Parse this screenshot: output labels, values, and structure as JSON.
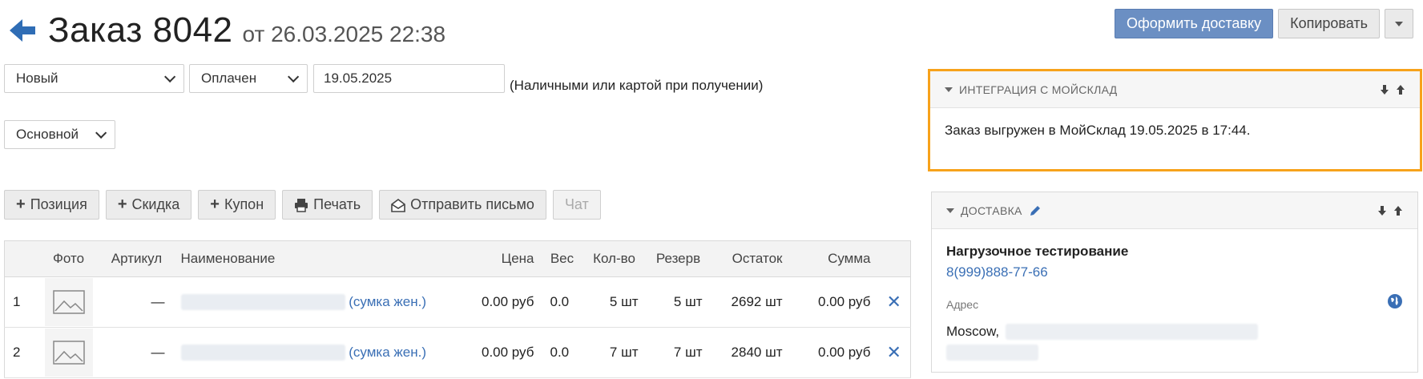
{
  "header": {
    "title": "Заказ 8042",
    "from_label": "от 26.03.2025 22:38"
  },
  "actions": {
    "primary": "Оформить доставку",
    "copy": "Копировать"
  },
  "form": {
    "status": "Новый",
    "payment_status": "Оплачен",
    "date": "19.05.2025",
    "payment_note": "(Наличными или картой при получении)",
    "warehouse": "Основной"
  },
  "toolbar": {
    "position": "Позиция",
    "discount": "Скидка",
    "coupon": "Купон",
    "print": "Печать",
    "send_email": "Отправить письмо",
    "chat": "Чат"
  },
  "table": {
    "headers": {
      "photo": "Фото",
      "sku": "Артикул",
      "name": "Наименование",
      "price": "Цена",
      "weight": "Вес",
      "qty": "Кол-во",
      "reserve": "Резерв",
      "stock": "Остаток",
      "sum": "Сумма"
    },
    "rows": [
      {
        "idx": "1",
        "sku": "—",
        "name_suffix": "(сумка жен.)",
        "price": "0.00 руб",
        "weight": "0.0",
        "qty": "5 шт",
        "reserve": "5 шт",
        "stock": "2692 шт",
        "sum": "0.00 руб"
      },
      {
        "idx": "2",
        "sku": "—",
        "name_suffix": "(сумка жен.)",
        "price": "0.00 руб",
        "weight": "0.0",
        "qty": "7 шт",
        "reserve": "7 шт",
        "stock": "2840 шт",
        "sum": "0.00 руб"
      }
    ]
  },
  "integration_panel": {
    "title": "ИНТЕГРАЦИЯ С МОЙСКЛАД",
    "message": "Заказ выгружен в МойСклад 19.05.2025 в 17:44."
  },
  "delivery_panel": {
    "title": "ДОСТАВКА",
    "contact_name": "Нагрузочное тестирование",
    "phone": "8(999)888-77-66",
    "address_label": "Адрес",
    "city": "Moscow,"
  },
  "colors": {
    "accent_blue": "#3a6fb5",
    "primary_button": "#6b8fc3",
    "highlight_border": "#f7a21b"
  }
}
